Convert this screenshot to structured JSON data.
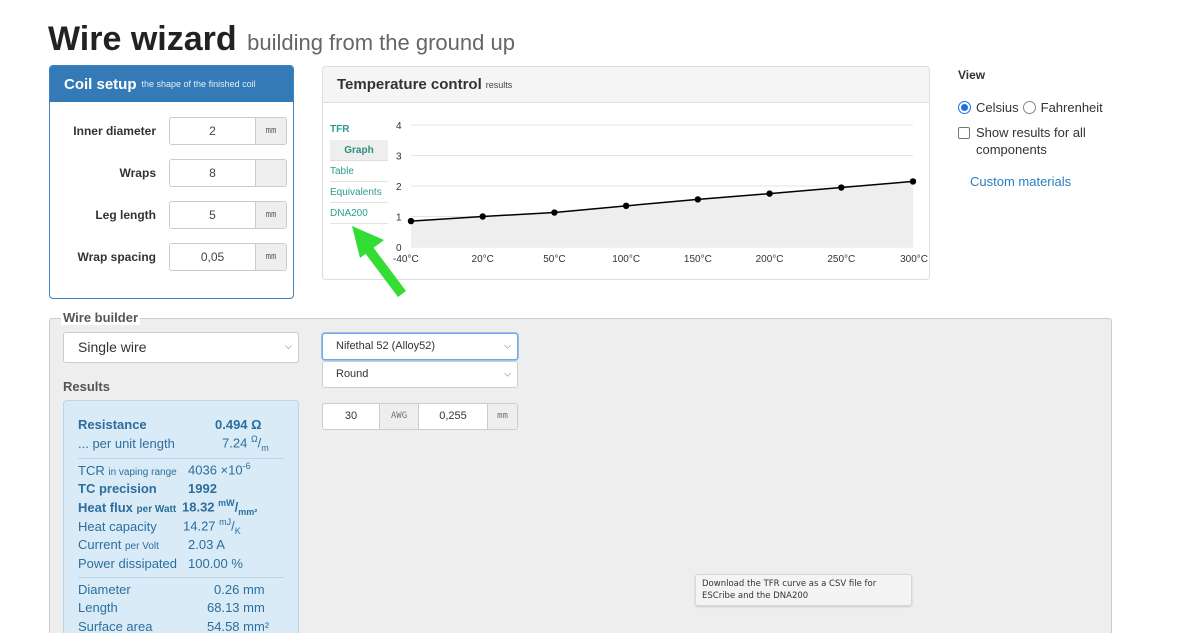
{
  "header": {
    "title": "Wire wizard",
    "subtitle": "building from the ground up"
  },
  "coil_setup": {
    "title": "Coil setup",
    "subtitle": "the shape of the finished coil",
    "fields": [
      {
        "label": "Inner diameter",
        "value": "2",
        "unit": "mm"
      },
      {
        "label": "Wraps",
        "value": "8",
        "unit": ""
      },
      {
        "label": "Leg length",
        "value": "5",
        "unit": "mm"
      },
      {
        "label": "Wrap spacing",
        "value": "0,05",
        "unit": "mm"
      }
    ]
  },
  "temperature_control": {
    "title": "Temperature control",
    "subtitle": "results",
    "tabs": [
      "TFR",
      "Graph",
      "Table",
      "Equivalents",
      "DNA200"
    ],
    "active_tab": "Graph"
  },
  "chart_data": {
    "type": "line",
    "title": "",
    "xlabel": "",
    "ylabel": "",
    "categories": [
      "-40°C",
      "20°C",
      "50°C",
      "100°C",
      "150°C",
      "200°C",
      "250°C",
      "300°C"
    ],
    "series": [
      {
        "values": [
          0.85,
          1.0,
          1.13,
          1.35,
          1.56,
          1.75,
          1.95,
          2.15
        ]
      }
    ],
    "y_ticks": [
      "0",
      "1",
      "2",
      "3",
      "4"
    ],
    "ylim": [
      0,
      4
    ],
    "grid": true,
    "colors": {
      "line": "#000000",
      "fill": "#eeeeee",
      "grid": "#e4e4e4"
    }
  },
  "annotation": {
    "arrow_color": "#33dd33"
  },
  "view": {
    "heading": "View",
    "units": [
      {
        "label": "Celsius",
        "selected": true
      },
      {
        "label": "Fahrenheit",
        "selected": false
      }
    ],
    "show_all_label": "Show results for all components",
    "custom_materials_link": "Custom materials"
  },
  "wire_builder": {
    "legend": "Wire builder",
    "wire_type": "Single wire",
    "material": "Nifethal 52 (Alloy52)",
    "profile": "Round",
    "gauge": {
      "awg_value": "30",
      "awg_unit": "AWG",
      "mm_value": "0,255",
      "mm_unit": "mm"
    },
    "results_heading": "Results",
    "results": {
      "resistance": {
        "label": "Resistance",
        "value": "0.494",
        "unit": "Ω"
      },
      "per_length": {
        "label": "... per unit length",
        "value": "7.24",
        "unit_num": "Ω",
        "unit_den": "m"
      },
      "tcr": {
        "label": "TCR",
        "label_small": "in vaping range",
        "value": "4036",
        "unit": "×10",
        "exp": "-6"
      },
      "tc_precision": {
        "label": "TC precision",
        "value": "1992"
      },
      "heat_flux": {
        "label": "Heat flux",
        "label_small": "per Watt",
        "value": "18.32",
        "unit_num": "mW",
        "unit_den": "mm²"
      },
      "heat_capacity": {
        "label": "Heat capacity",
        "value": "14.27",
        "unit_num": "mJ",
        "unit_den": "K"
      },
      "current": {
        "label": "Current",
        "label_small": "per Volt",
        "value": "2.03",
        "unit": "A"
      },
      "power": {
        "label": "Power dissipated",
        "value": "100.00",
        "unit": "%"
      },
      "diameter": {
        "label": "Diameter",
        "value": "0.26",
        "unit": "mm"
      },
      "length": {
        "label": "Length",
        "value": "68.13",
        "unit": "mm"
      },
      "surface_area": {
        "label": "Surface area",
        "value": "54.58",
        "unit": "mm²"
      }
    }
  },
  "tooltip": {
    "text": "Download the TFR curve as a CSV file for ESCribe and the DNA200"
  }
}
